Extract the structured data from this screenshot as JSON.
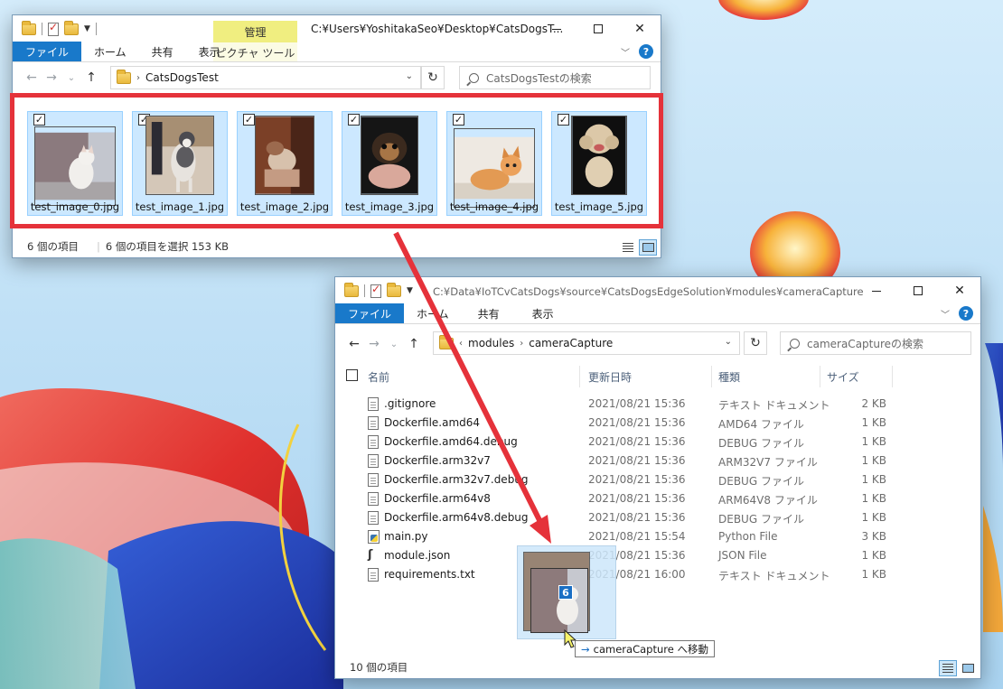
{
  "window1": {
    "path": "C:¥Users¥YoshitakaSeo¥Desktop¥CatsDogsT...",
    "context_group": "管理",
    "tabs": [
      "ファイル",
      "ホーム",
      "共有",
      "表示"
    ],
    "context_tab": "ピクチャ ツール",
    "breadcrumb": "CatsDogsTest",
    "search_placeholder": "CatsDogsTestの検索",
    "thumbnails": [
      {
        "name": "test_image_0.jpg",
        "checked": true
      },
      {
        "name": "test_image_1.jpg",
        "checked": true
      },
      {
        "name": "test_image_2.jpg",
        "checked": true
      },
      {
        "name": "test_image_3.jpg",
        "checked": true
      },
      {
        "name": "test_image_4.jpg",
        "checked": true
      },
      {
        "name": "test_image_5.jpg",
        "checked": true
      }
    ],
    "status_items": "6 個の項目",
    "status_selected": "6 個の項目を選択  153 KB"
  },
  "window2": {
    "path": "C:¥Data¥IoTCvCatsDogs¥source¥CatsDogsEdgeSolution¥modules¥cameraCapture",
    "tabs": [
      "ファイル",
      "ホーム",
      "共有",
      "表示"
    ],
    "breadcrumb": [
      "modules",
      "cameraCapture"
    ],
    "search_placeholder": "cameraCaptureの検索",
    "columns": {
      "name": "名前",
      "date": "更新日時",
      "type": "種類",
      "size": "サイズ"
    },
    "files": [
      {
        "name": ".gitignore",
        "date": "2021/08/21 15:36",
        "type": "テキスト ドキュメント",
        "size": "2 KB",
        "icon": "doc"
      },
      {
        "name": "Dockerfile.amd64",
        "date": "2021/08/21 15:36",
        "type": "AMD64 ファイル",
        "size": "1 KB",
        "icon": "doc"
      },
      {
        "name": "Dockerfile.amd64.debug",
        "date": "2021/08/21 15:36",
        "type": "DEBUG ファイル",
        "size": "1 KB",
        "icon": "doc"
      },
      {
        "name": "Dockerfile.arm32v7",
        "date": "2021/08/21 15:36",
        "type": "ARM32V7 ファイル",
        "size": "1 KB",
        "icon": "doc"
      },
      {
        "name": "Dockerfile.arm32v7.debug",
        "date": "2021/08/21 15:36",
        "type": "DEBUG ファイル",
        "size": "1 KB",
        "icon": "doc"
      },
      {
        "name": "Dockerfile.arm64v8",
        "date": "2021/08/21 15:36",
        "type": "ARM64V8 ファイル",
        "size": "1 KB",
        "icon": "doc"
      },
      {
        "name": "Dockerfile.arm64v8.debug",
        "date": "2021/08/21 15:36",
        "type": "DEBUG ファイル",
        "size": "1 KB",
        "icon": "doc"
      },
      {
        "name": "main.py",
        "date": "2021/08/21 15:54",
        "type": "Python File",
        "size": "3 KB",
        "icon": "python"
      },
      {
        "name": "module.json",
        "date": "2021/08/21 15:36",
        "type": "JSON File",
        "size": "1 KB",
        "icon": "json"
      },
      {
        "name": "requirements.txt",
        "date": "2021/08/21 16:00",
        "type": "テキスト ドキュメント",
        "size": "1 KB",
        "icon": "doc"
      }
    ],
    "status_items": "10 個の項目"
  },
  "drag": {
    "count": "6",
    "tooltip": "cameraCapture へ移動"
  },
  "colors": {
    "highlight": "#e5323a",
    "accent": "#1979ca",
    "selection": "#cce8ff",
    "context_tab": "#f0ee80"
  }
}
